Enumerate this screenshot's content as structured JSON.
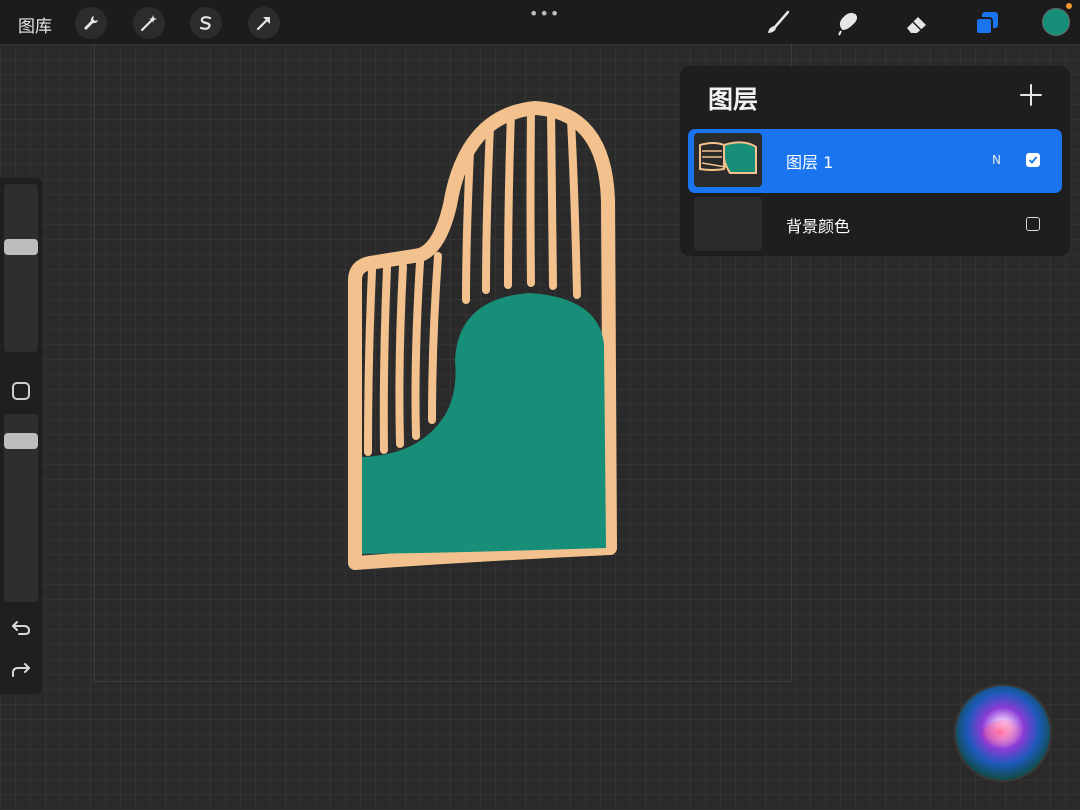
{
  "toolbar": {
    "gallery_label": "图库",
    "left_tools": [
      "wrench-icon",
      "magic-wand-icon",
      "selection-icon",
      "transform-arrow-icon"
    ],
    "more_dots": "•••",
    "right_tools": [
      "brush-icon",
      "smudge-icon",
      "eraser-icon",
      "layers-icon"
    ],
    "active_color": "#178e78"
  },
  "sidebar": {
    "brush_size_level": 0.4,
    "opacity_level": 0.95,
    "undo_icon": "undo-icon",
    "redo_icon": "redo-icon"
  },
  "layers_panel": {
    "title": "图层",
    "add_icon": "plus-icon",
    "layers": [
      {
        "name": "图层 1",
        "blend_mode": "N",
        "visible": true,
        "selected": true
      },
      {
        "name": "背景颜色",
        "blend_mode": "",
        "visible": false,
        "selected": false
      }
    ]
  },
  "artwork": {
    "outline_color": "#f2c18d",
    "fill_color": "#178e78",
    "subject": "stylized grand piano"
  },
  "colors": {
    "accent_blue": "#1a74f0",
    "toolbar_bg": "#1c1c1c",
    "canvas_bg": "#2a2a2a"
  }
}
